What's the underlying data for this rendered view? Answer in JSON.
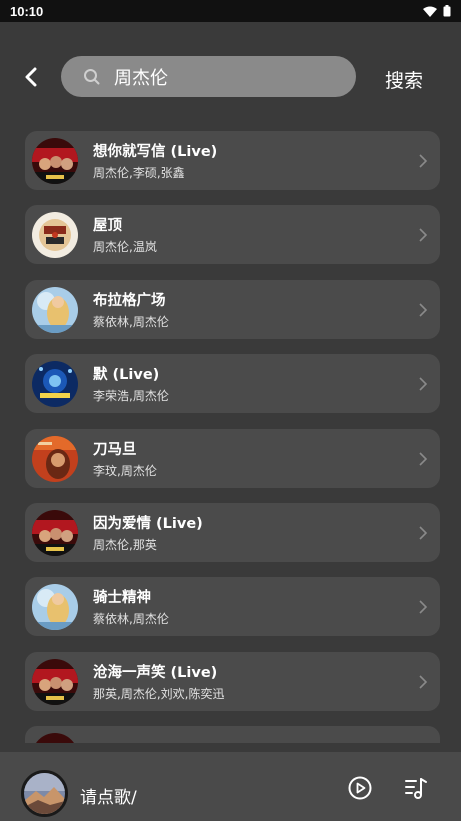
{
  "status": {
    "time": "10:10"
  },
  "search": {
    "value": "周杰伦",
    "button": "搜索"
  },
  "songs": [
    {
      "title": "想你就写信 (Live)",
      "artist": "周杰伦,李硕,张鑫"
    },
    {
      "title": "屋顶",
      "artist": "周杰伦,温岚"
    },
    {
      "title": "布拉格广场",
      "artist": "蔡依林,周杰伦"
    },
    {
      "title": "默 (Live)",
      "artist": "李荣浩,周杰伦"
    },
    {
      "title": "刀马旦",
      "artist": "李玟,周杰伦"
    },
    {
      "title": "因为爱情 (Live)",
      "artist": "周杰伦,那英"
    },
    {
      "title": "骑士精神",
      "artist": "蔡依林,周杰伦"
    },
    {
      "title": "沧海一声笑 (Live)",
      "artist": "那英,周杰伦,刘欢,陈奕迅"
    }
  ],
  "player": {
    "label": "请点歌/"
  },
  "icons": {
    "back": "back-arrow-icon",
    "search": "search-icon",
    "chevron": "chevron-right-icon",
    "play": "play-circle-icon",
    "queue": "playlist-icon"
  }
}
